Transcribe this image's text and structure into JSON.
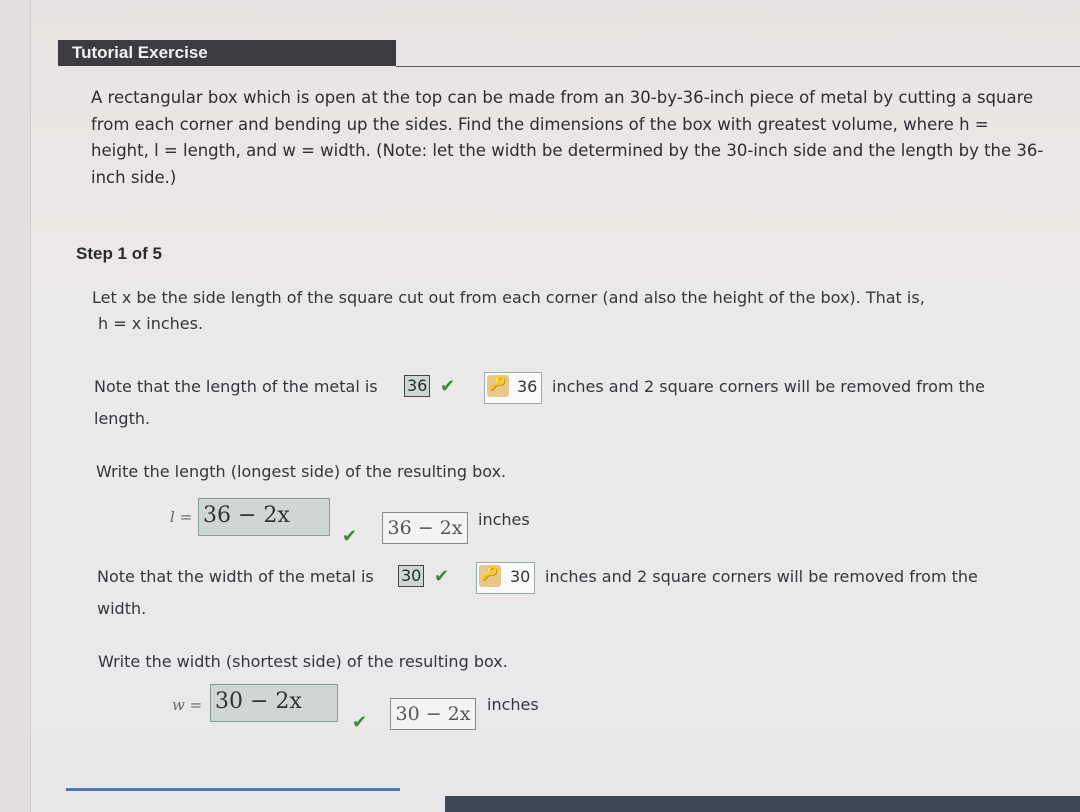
{
  "header": {
    "title": "Tutorial Exercise"
  },
  "problem": {
    "text": "A rectangular box which is open at the top can be made from an 30-by-36-inch piece of metal by cutting a square from each corner and bending up the sides. Find the dimensions of the box with greatest volume, where h = height, l = length, and w = width. (Note: let the width be determined by the 30-inch side and the length by the 36-inch side.)"
  },
  "step": {
    "label": "Step 1 of 5",
    "intro_line1": "Let x be the side length of the square cut out from each corner (and also the height of the box). That is,",
    "intro_line2": "h = x inches.",
    "length_note": {
      "prefix": "Note that the length of the metal is",
      "entered": "36",
      "answer": "36",
      "suffix": "inches and 2 square corners will be removed from the",
      "cont": "length."
    },
    "length_prompt": "Write the length (longest side) of the resulting box.",
    "length_input": {
      "label": "l =",
      "value": "36 − 2x",
      "answer": "36 − 2x",
      "unit": "inches"
    },
    "width_note": {
      "prefix": "Note that the width of the metal is",
      "entered": "30",
      "answer": "30",
      "suffix": "inches and 2 square corners will be removed from the",
      "cont": "width."
    },
    "width_prompt": "Write the width (shortest side) of the resulting box.",
    "width_input": {
      "label": "w =",
      "value": "30 − 2x",
      "answer": "30 − 2x",
      "unit": "inches"
    }
  },
  "icons": {
    "correct": "checkmark-icon",
    "key": "key-icon"
  }
}
